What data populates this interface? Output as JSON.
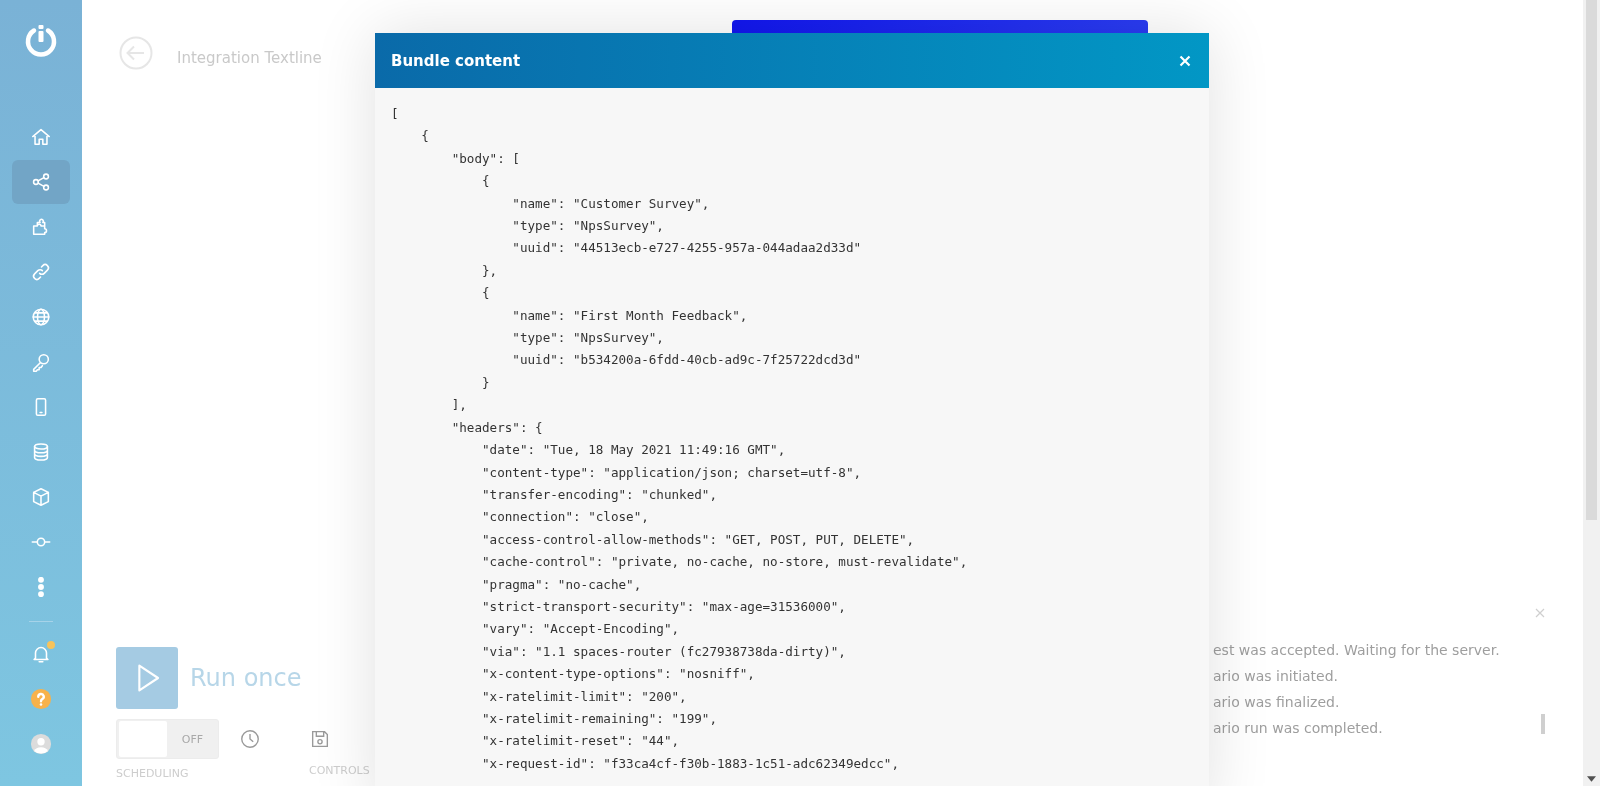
{
  "sidebar": {
    "items": [
      {
        "kind": "home",
        "selected": false
      },
      {
        "kind": "share",
        "selected": true
      },
      {
        "kind": "puzzle",
        "selected": false
      },
      {
        "kind": "link",
        "selected": false
      },
      {
        "kind": "globe",
        "selected": false
      },
      {
        "kind": "key",
        "selected": false
      },
      {
        "kind": "mobile",
        "selected": false
      },
      {
        "kind": "database",
        "selected": false
      },
      {
        "kind": "cube",
        "selected": false
      },
      {
        "kind": "commit",
        "selected": false
      },
      {
        "kind": "more",
        "selected": false
      }
    ],
    "bottom": [
      {
        "kind": "bell",
        "notification": true
      },
      {
        "kind": "help",
        "notification": false
      },
      {
        "kind": "avatar",
        "notification": false
      }
    ]
  },
  "scenario": {
    "title": "Integration Textline",
    "run_label": "Run once",
    "scheduling": {
      "on": false,
      "toggle_label": "OFF",
      "label": "SCHEDULING"
    },
    "controls_label": "CONTROLS"
  },
  "log": {
    "messages": [
      "est was accepted. Waiting for the server.",
      "ario was initiated.",
      "ario was finalized.",
      "ario run was completed."
    ]
  },
  "modal": {
    "title": "Bundle content",
    "lines": [
      "[",
      "    {",
      "        \"body\": [",
      "            {",
      "                \"name\": \"Customer Survey\",",
      "                \"type\": \"NpsSurvey\",",
      "                \"uuid\": \"44513ecb-e727-4255-957a-044adaa2d33d\"",
      "            },",
      "            {",
      "                \"name\": \"First Month Feedback\",",
      "                \"type\": \"NpsSurvey\",",
      "                \"uuid\": \"b534200a-6fdd-40cb-ad9c-7f25722dcd3d\"",
      "            }",
      "        ],",
      "        \"headers\": {",
      "            \"date\": \"Tue, 18 May 2021 11:49:16 GMT\",",
      "            \"content-type\": \"application/json; charset=utf-8\",",
      "            \"transfer-encoding\": \"chunked\",",
      "            \"connection\": \"close\",",
      "            \"access-control-allow-methods\": \"GET, POST, PUT, DELETE\",",
      "            \"cache-control\": \"private, no-cache, no-store, must-revalidate\",",
      "            \"pragma\": \"no-cache\",",
      "            \"strict-transport-security\": \"max-age=31536000\",",
      "            \"vary\": \"Accept-Encoding\",",
      "            \"via\": \"1.1 spaces-router (fc27938738da-dirty)\",",
      "            \"x-content-type-options\": \"nosniff\",",
      "            \"x-ratelimit-limit\": \"200\",",
      "            \"x-ratelimit-remaining\": \"199\",",
      "            \"x-ratelimit-reset\": \"44\",",
      "            \"x-request-id\": \"f33ca4cf-f30b-1883-1c51-adc62349edcc\","
    ]
  }
}
